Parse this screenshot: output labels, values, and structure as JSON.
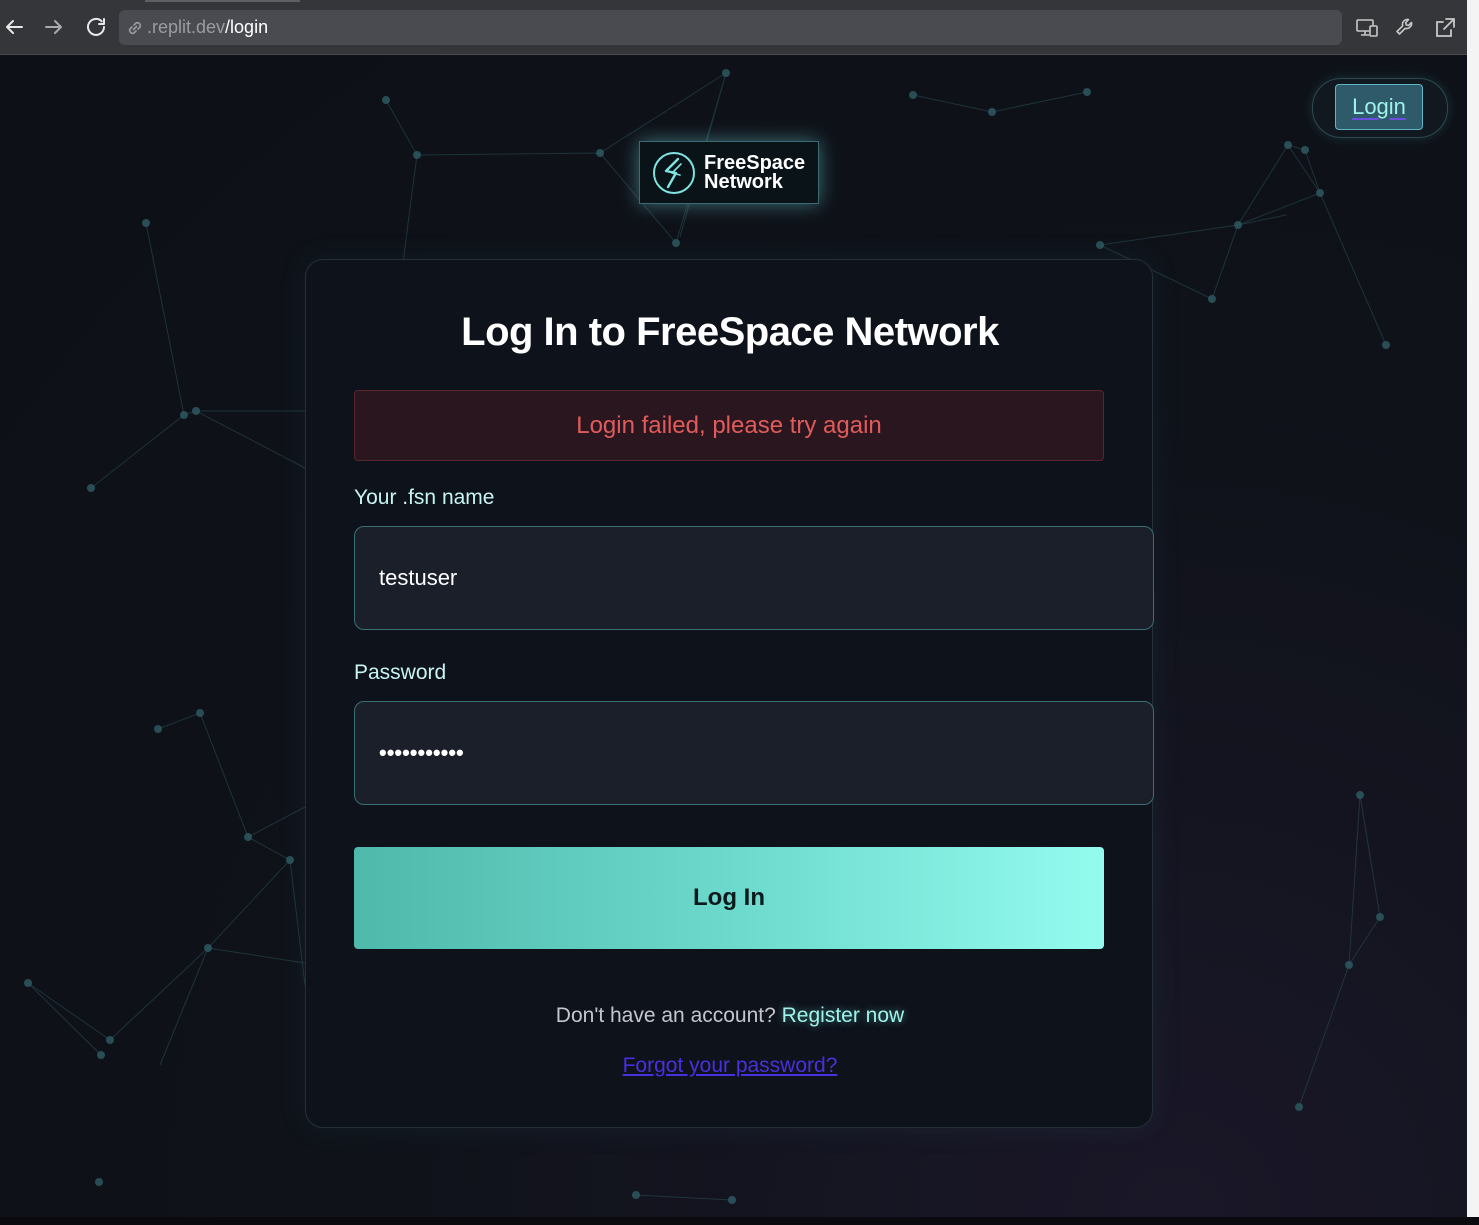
{
  "browser": {
    "url_domain": ".replit.dev",
    "url_path": "/login",
    "icons": {
      "back": "arrow-left-icon",
      "forward": "arrow-right-icon",
      "reload": "reload-icon",
      "link": "link-icon",
      "devices": "devices-icon",
      "tools": "wrench-icon",
      "open_external": "external-link-icon"
    }
  },
  "header": {
    "login_button": "Login"
  },
  "logo": {
    "line1": "FreeSpace",
    "line2": "Network"
  },
  "form": {
    "title": "Log In to FreeSpace Network",
    "error_message": "Login failed, please try again",
    "username_label": "Your .fsn name",
    "username_value": "testuser",
    "password_label": "Password",
    "password_value": "•••••••••••",
    "submit_label": "Log In",
    "register_prompt": "Don't have an account?",
    "register_link": "Register now",
    "forgot_link": "Forgot your password?"
  },
  "colors": {
    "accent": "#5ed3c5",
    "error": "#e25b5b",
    "link": "#4a2fe0"
  }
}
